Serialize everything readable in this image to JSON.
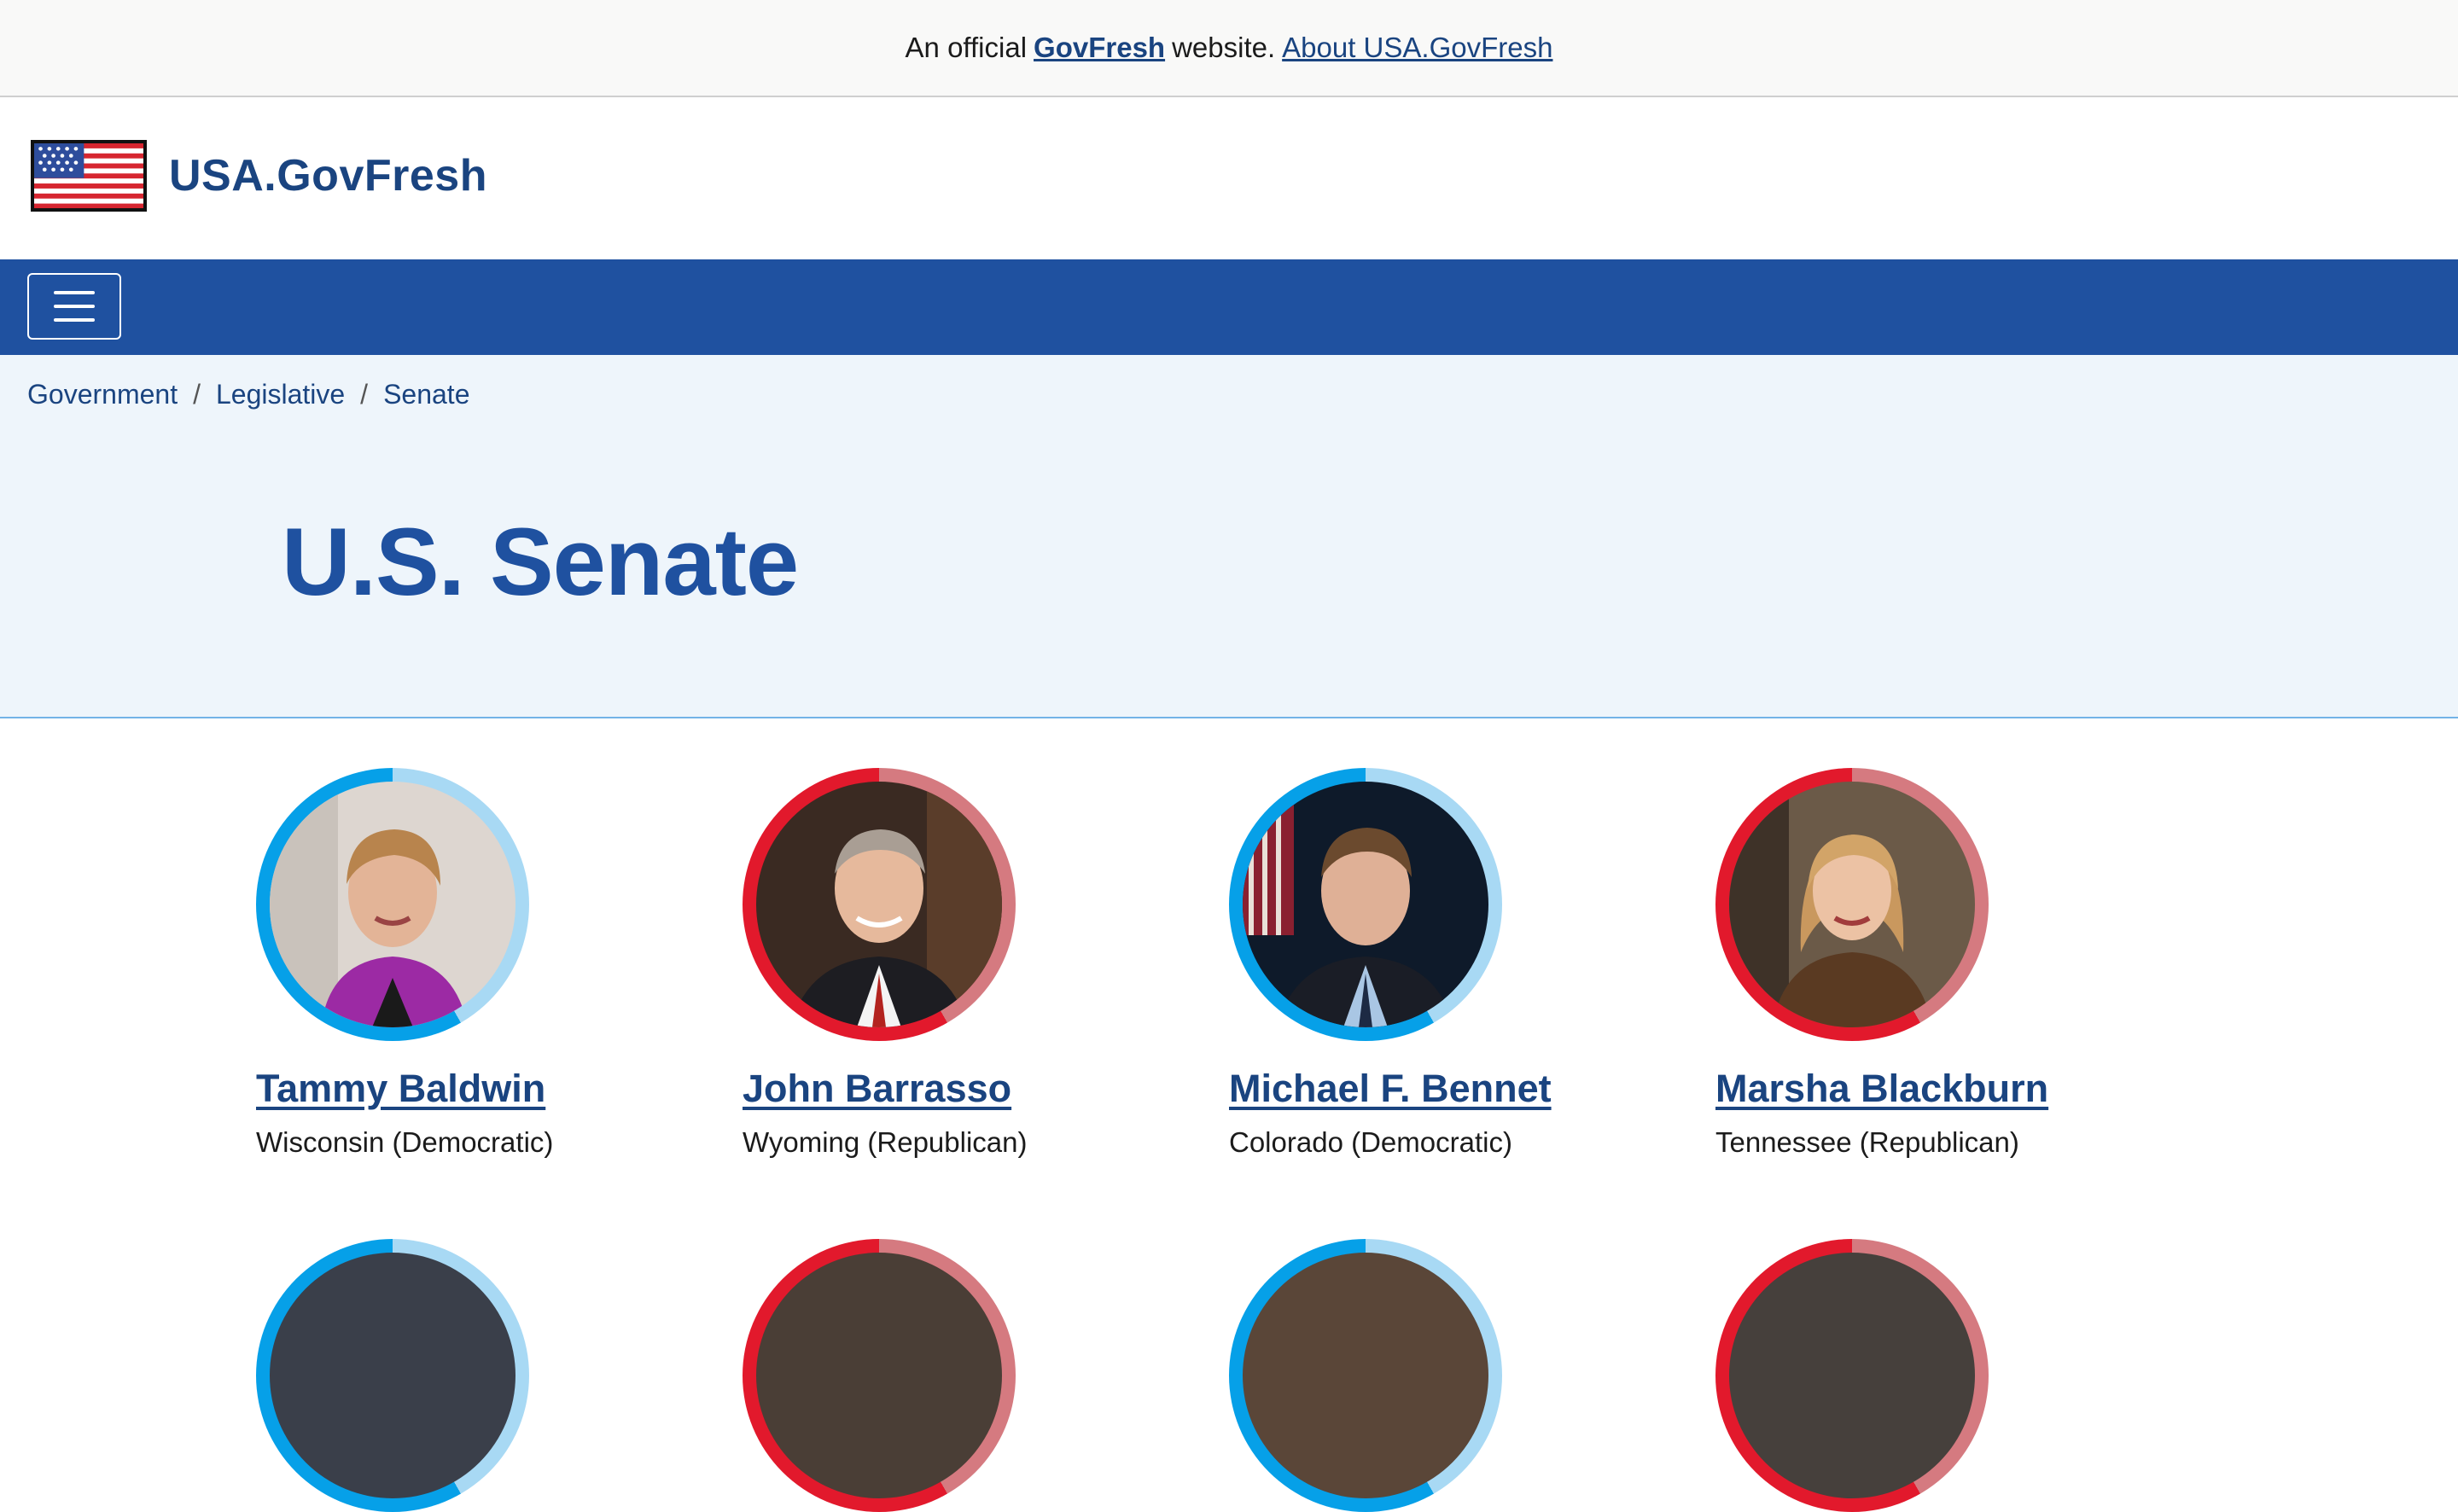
{
  "banner": {
    "prefix": "An official",
    "brand": "GovFresh",
    "middle": "website.",
    "about_link": "About USA.GovFresh"
  },
  "header": {
    "site_title": "USA.GovFresh",
    "flag_icon": "us-flag-icon"
  },
  "nav": {
    "menu_icon": "hamburger-menu-icon"
  },
  "breadcrumb": [
    "Government",
    "Legislative",
    "Senate"
  ],
  "page": {
    "title": "U.S. Senate"
  },
  "colors": {
    "brand_blue": "#1a4480",
    "nav_blue": "#1f51a0",
    "hero_bg": "#eef5fb",
    "democratic": "#06a0e8",
    "republican": "#e2192c"
  },
  "senators": [
    {
      "name": "Tammy Baldwin",
      "state_party": "Wisconsin (Democratic)",
      "party": "democratic"
    },
    {
      "name": "John Barrasso",
      "state_party": "Wyoming (Republican)",
      "party": "republican"
    },
    {
      "name": "Michael F. Bennet",
      "state_party": "Colorado (Democratic)",
      "party": "democratic"
    },
    {
      "name": "Marsha Blackburn",
      "state_party": "Tennessee (Republican)",
      "party": "republican"
    }
  ]
}
